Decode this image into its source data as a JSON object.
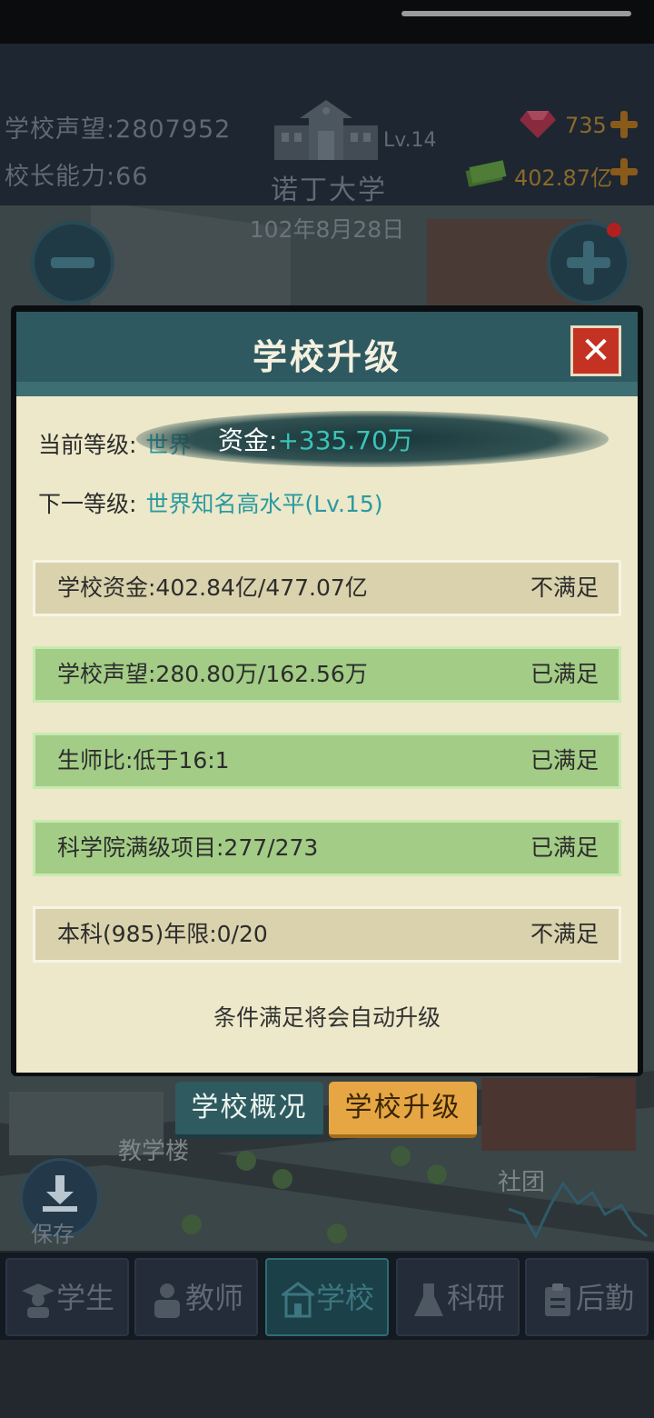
{
  "hud": {
    "reputation_label": "学校声望:",
    "reputation_value": "2807952",
    "ability_label": "校长能力:",
    "ability_value": "66",
    "level": "Lv.14",
    "school_name": "诺丁大学",
    "gems": "735",
    "money": "402.87亿",
    "date": "102年8月28日"
  },
  "dialog": {
    "title": "学校升级",
    "close_label": "✕",
    "current_level_label": "当前等级:",
    "current_level_value": "世界",
    "next_level_label": "下一等级:",
    "next_level_value": "世界知名高水平(Lv.15)",
    "toast_label": "资金:",
    "toast_value": "+335.70万",
    "conditions": [
      {
        "label": "学校资金:402.84亿/477.07亿",
        "status": "不满足",
        "met": false
      },
      {
        "label": "学校声望:280.80万/162.56万",
        "status": "已满足",
        "met": true
      },
      {
        "label": "生师比:低于16:1",
        "status": "已满足",
        "met": true
      },
      {
        "label": "科学院满级项目:277/273",
        "status": "已满足",
        "met": true
      },
      {
        "label": "本科(985)年限:0/20",
        "status": "不满足",
        "met": false
      }
    ],
    "footnote": "条件满足将会自动升级"
  },
  "tabs": {
    "overview": "学校概况",
    "upgrade": "学校升级"
  },
  "map": {
    "teaching_building": "教学楼",
    "club": "社团",
    "save_label": "保存"
  },
  "nav": {
    "students": "学生",
    "teachers": "教师",
    "school": "学校",
    "research": "科研",
    "logistics": "后勤"
  },
  "colors": {
    "met": "#a3cc86",
    "unmet": "#d9d2ac",
    "accent": "#2a9aa0",
    "upgrade_tab": "#e6a643"
  }
}
